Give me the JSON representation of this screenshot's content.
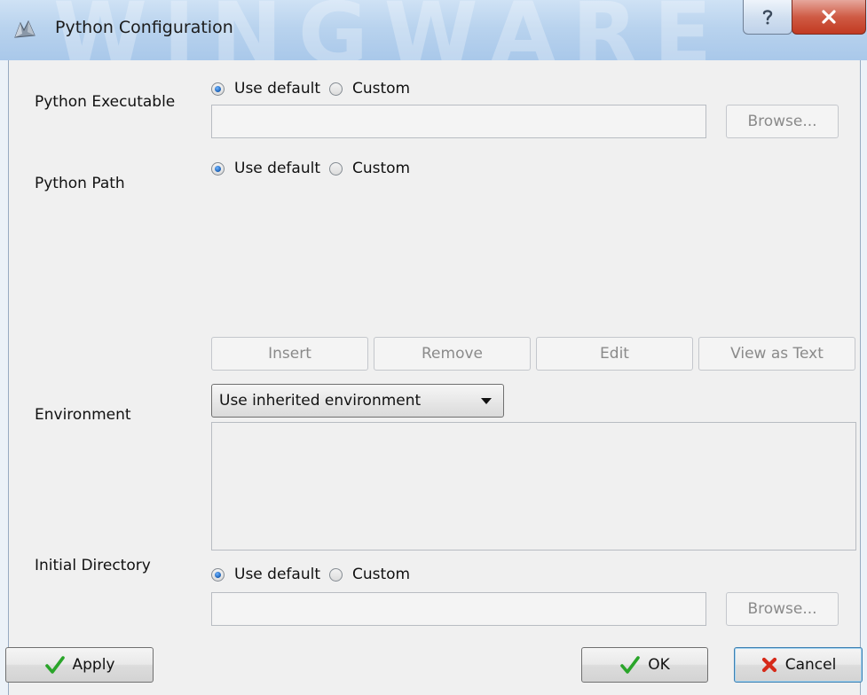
{
  "window": {
    "title": "Python Configuration",
    "watermark": "WINGWARE"
  },
  "icons": {
    "app": "wing-ide-app-icon",
    "help": "question-mark-icon",
    "close": "close-x-icon",
    "apply": "green-checkmark-icon",
    "ok": "green-checkmark-icon",
    "cancel": "red-x-icon"
  },
  "python_executable": {
    "label": "Python Executable",
    "option_default": "Use default",
    "option_custom": "Custom",
    "selected": "Use default",
    "path_value": "",
    "browse_label": "Browse..."
  },
  "python_path": {
    "label": "Python Path",
    "option_default": "Use default",
    "option_custom": "Custom",
    "selected": "Use default",
    "buttons": {
      "insert": "Insert",
      "remove": "Remove",
      "edit": "Edit",
      "view_as_text": "View as Text"
    }
  },
  "environment": {
    "label": "Environment",
    "selected": "Use inherited environment",
    "text_value": ""
  },
  "initial_directory": {
    "label": "Initial Directory",
    "option_default": "Use default",
    "option_custom": "Custom",
    "selected": "Use default",
    "path_value": "",
    "browse_label": "Browse..."
  },
  "footer": {
    "apply": "Apply",
    "ok": "OK",
    "cancel": "Cancel"
  },
  "colors": {
    "titlebar": "#b9d3ee",
    "client_bg": "#f0f0f0",
    "radio_selected": "#1a5fb4",
    "check_green": "#2aa52a",
    "cancel_red": "#d62a1a",
    "close_button": "#c23a21"
  }
}
